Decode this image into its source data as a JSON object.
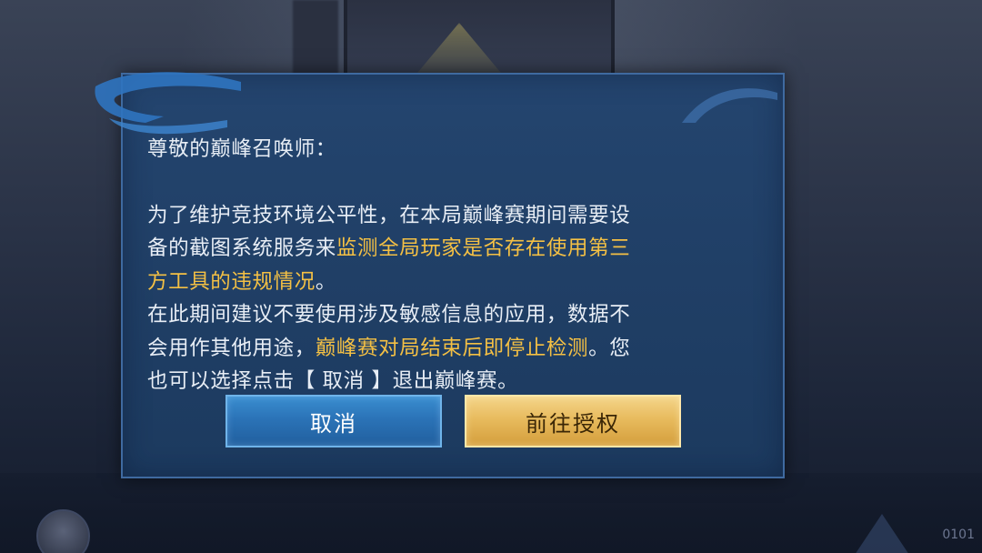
{
  "dialog": {
    "greeting": "尊敬的巅峰召唤师：",
    "paragraph1": {
      "line1": "为了维护竞技环境公平性，在本局巅峰赛期间需要设",
      "line2_normal": "备的截图系统服务来",
      "line2_highlight": "监测全局玩家是否存在使用第三",
      "line3_highlight": "方工具的违规情况",
      "line3_end": "。"
    },
    "paragraph2": {
      "line1": "在此期间建议不要使用涉及敏感信息的应用，数据不",
      "line2_normal": "会用作其他用途，",
      "line2_highlight": "巅峰赛对局结束后即停止检测",
      "line2_end": "。您",
      "line3": "也可以选择点击【 取消 】退出巅峰赛。"
    },
    "cancel_label": "取消",
    "confirm_label": "前往授权"
  },
  "background": {
    "corner_text": "0101"
  },
  "colors": {
    "dialog_bg": "#22426b",
    "highlight_text": "#f4c044",
    "cancel_button": "#2b73b7",
    "confirm_button": "#e8bb5e"
  }
}
